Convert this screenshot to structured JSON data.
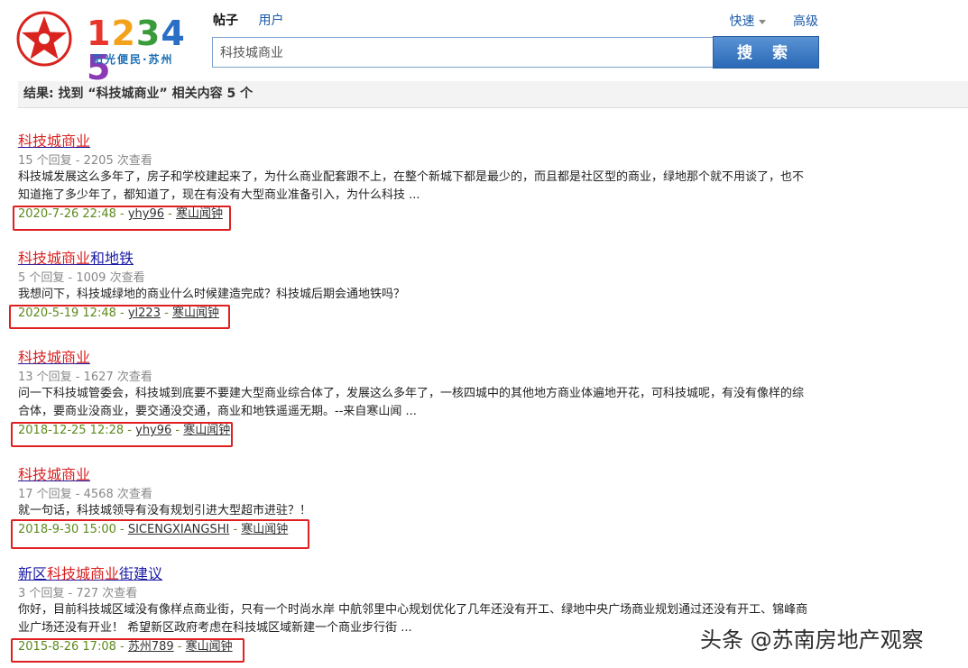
{
  "logo": {
    "number": [
      "1",
      "2",
      "3",
      "4",
      "5"
    ],
    "number_colors": [
      "#e8362c",
      "#f4a11c",
      "#3a9b3b",
      "#2a6ec5",
      "#8a3ab5"
    ],
    "subtitle": "阳光便民·苏州",
    "star_color": "#d8231f",
    "icon": "star-logo-icon"
  },
  "tabs": [
    {
      "label": "帖子",
      "active": true
    },
    {
      "label": "用户",
      "active": false
    }
  ],
  "top_links": {
    "quick": "快速",
    "advanced": "高级"
  },
  "search": {
    "value": "科技城商业",
    "button": "搜 索"
  },
  "result_summary": "结果: 找到 “科技城商业” 相关内容 5 个",
  "results": [
    {
      "title_parts": [
        {
          "text": "科技城商业",
          "hl": true
        }
      ],
      "stats": "15 个回复 - 2205 次查看",
      "excerpt": "科技城发展这么多年了，房子和学校建起来了，为什么商业配套跟不上，在整个新城下都是最少的，而且都是社区型的商业，绿地那个就不用谈了，也不知道拖了多少年了，都知道了，现在有没有大型商业准备引入，为什么科技 ...",
      "date": "2020-7-26 22:48",
      "user": "yhy96",
      "forum": "寒山闻钟"
    },
    {
      "title_parts": [
        {
          "text": "科技城商业",
          "hl": true
        },
        {
          "text": "和地铁",
          "hl": false
        }
      ],
      "stats": "5 个回复 - 1009 次查看",
      "excerpt": "我想问下，科技城绿地的商业什么时候建造完成？科技城后期会通地铁吗？",
      "date": "2020-5-19 12:48",
      "user": "yl223",
      "forum": "寒山闻钟"
    },
    {
      "title_parts": [
        {
          "text": "科技城商业",
          "hl": true
        }
      ],
      "stats": "13 个回复 - 1627 次查看",
      "excerpt": "问一下科技城管委会，科技城到底要不要建大型商业综合体了，发展这么多年了，一核四城中的其他地方商业体遍地开花，可科技城呢，有没有像样的综合体，要商业没商业，要交通没交通，商业和地铁遥遥无期。--来自寒山闻 ...",
      "date": "2018-12-25 12:28",
      "user": "yhy96",
      "forum": "寒山闻钟"
    },
    {
      "title_parts": [
        {
          "text": "科技城商业",
          "hl": true
        }
      ],
      "stats": "17 个回复 - 4568 次查看",
      "excerpt": "就一句话，科技城领导有没有规划引进大型超市进驻？！",
      "date": "2018-9-30 15:00",
      "user": "SICENGXIANGSHI",
      "forum": "寒山闻钟"
    },
    {
      "title_parts": [
        {
          "text": "新区",
          "hl": false
        },
        {
          "text": "科技城商业",
          "hl": true
        },
        {
          "text": "街建议",
          "hl": false
        }
      ],
      "stats": "3 个回复 - 727 次查看",
      "excerpt": "你好，目前科技城区域没有像样点商业街，只有一个时尚水岸 中航邻里中心规划优化了几年还没有开工、绿地中央广场商业规划通过还没有开工、锦峰商业广场还没有开业！ 希望新区政府考虑在科技城区域新建一个商业步行街 ...",
      "date": "2015-8-26 17:08",
      "user": "苏州789",
      "forum": "寒山闻钟"
    }
  ],
  "watermark": "头条 @苏南房地产观察",
  "highlight_color": "#e02020"
}
